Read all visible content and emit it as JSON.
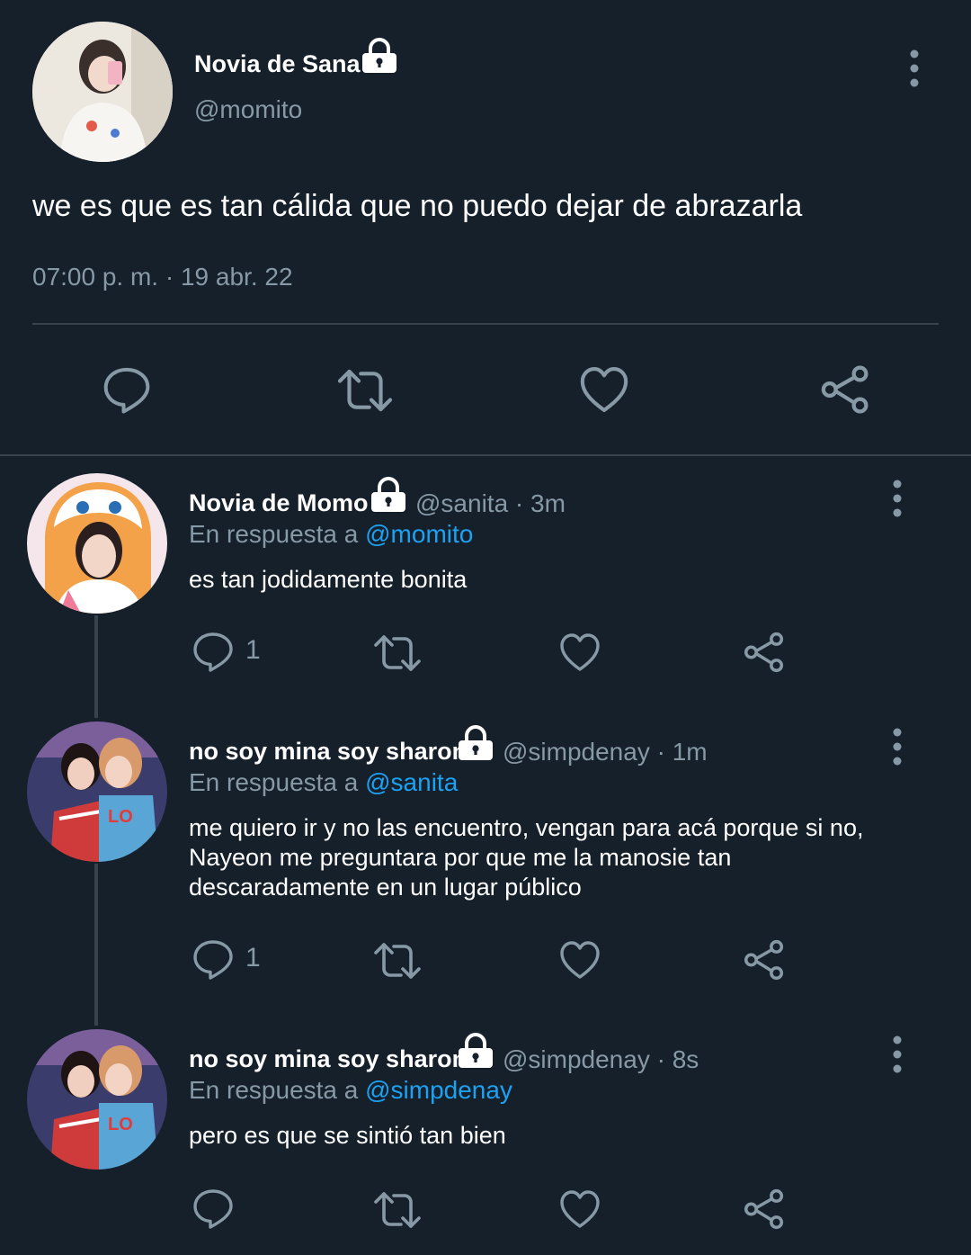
{
  "main_tweet": {
    "display_name": "Novia de Sana",
    "handle": "@momito",
    "text": "we es que es tan cálida que no puedo dejar de abrazarla",
    "timestamp": "07:00 p. m. · 19 abr. 22",
    "avatar_icon": "avatar-photo-momito"
  },
  "replies": [
    {
      "display_name": "Novia de Momo",
      "handle": "@sanita",
      "time": "· 3m",
      "reply_prefix": "En respuesta a",
      "reply_to": "@momito",
      "text": "es tan jodidamente bonita",
      "reply_count": "1"
    },
    {
      "display_name": "no soy mina soy sharon",
      "handle": "@simpdenay",
      "time": "· 1m",
      "reply_prefix": "En respuesta a",
      "reply_to": "@sanita",
      "text_lines": [
        "me quiero ir y no las encuentro, vengan para acá porque si no,",
        "Nayeon me preguntara por que me la manosie tan",
        "descaradamente en un lugar público"
      ],
      "reply_count": "1"
    },
    {
      "display_name": "no soy mina soy sharon",
      "handle": "@simpdenay",
      "time": "· 8s",
      "reply_prefix": "En respuesta a",
      "reply_to": "@simpdenay",
      "text": "pero es que se sintió tan bien",
      "reply_count": ""
    }
  ],
  "colors": {
    "background": "#15202b",
    "muted": "#8899a6",
    "link": "#1da1f2",
    "divider": "#38444d"
  }
}
